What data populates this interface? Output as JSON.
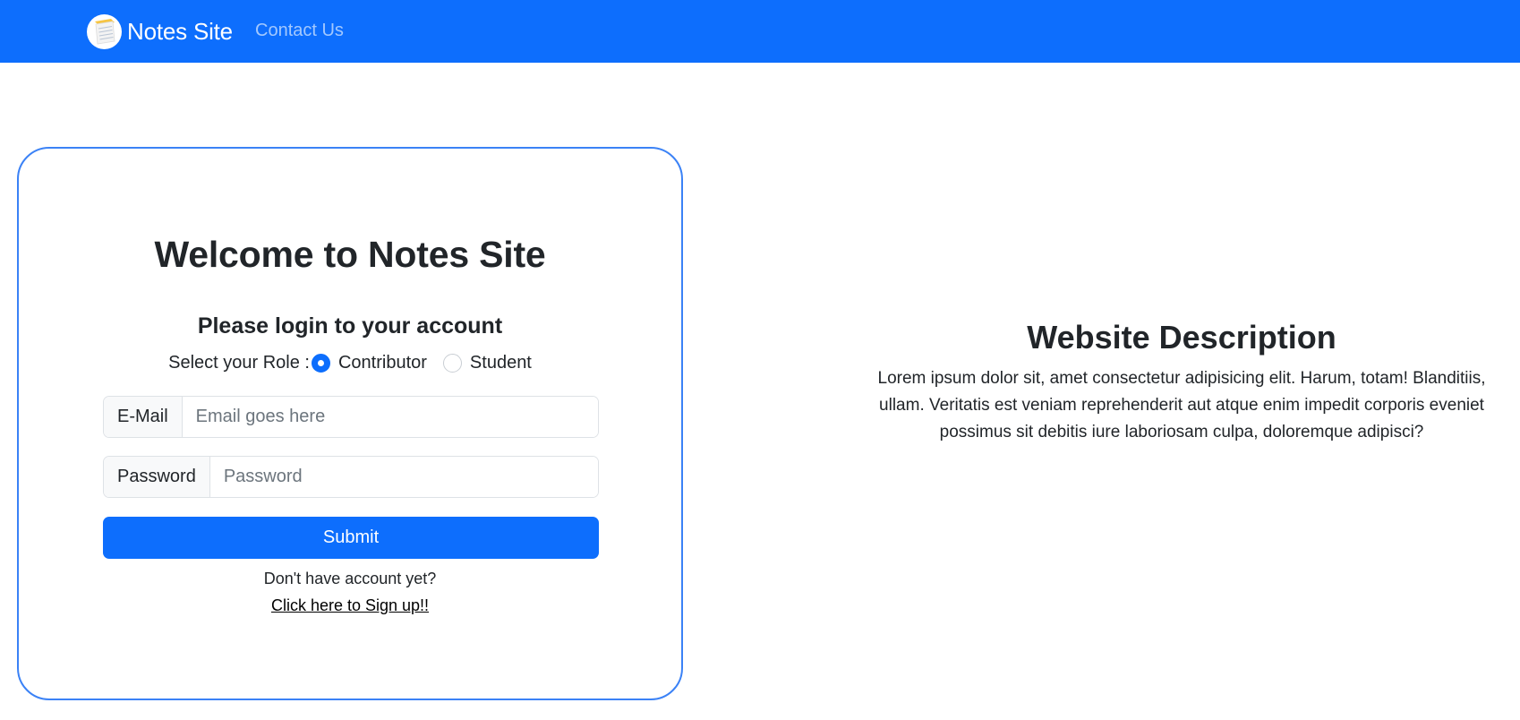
{
  "navbar": {
    "brand": "Notes Site",
    "brand_icon": "notebook-icon",
    "links": [
      "Contact Us"
    ],
    "colors": {
      "background": "#0d6efd"
    }
  },
  "login": {
    "heading": "Welcome to Notes Site",
    "subheading": "Please login to your account",
    "role_label": "Select your Role :",
    "roles": [
      {
        "label": "Contributor",
        "selected": true
      },
      {
        "label": "Student",
        "selected": false
      }
    ],
    "email": {
      "label": "E-Mail",
      "placeholder": "Email goes here",
      "value": ""
    },
    "password": {
      "label": "Password",
      "placeholder": "Password",
      "value": ""
    },
    "submit_label": "Submit",
    "no_account_text": "Don't have account yet?",
    "signup_link": "Click here to Sign up!!"
  },
  "description": {
    "title": "Website Description",
    "body": "Lorem ipsum dolor sit, amet consectetur adipisicing elit. Harum, totam! Blanditiis, ullam. Veritatis est veniam reprehenderit aut atque enim impedit corporis eveniet possimus sit debitis iure laboriosam culpa, doloremque adipisci?"
  },
  "colors": {
    "primary": "#0d6efd",
    "card_border": "#3b82f6"
  }
}
